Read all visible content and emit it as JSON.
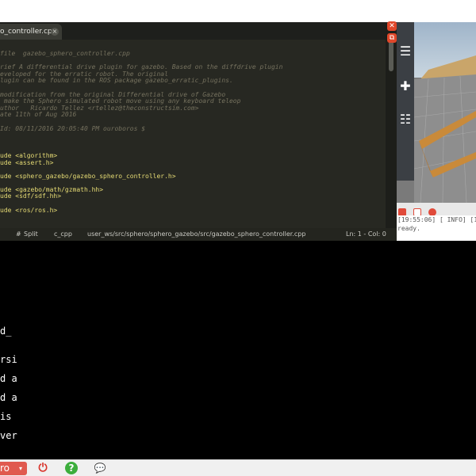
{
  "editor": {
    "tab_label": "o_controller.cpp",
    "tab_close_glyph": "×",
    "code_lines": [
      {
        "cls": "cm",
        "text": "file  gazebo_sphero_controller.cpp"
      },
      {
        "cls": "cm",
        "text": ""
      },
      {
        "cls": "cm",
        "text": "rief A differential drive plugin for gazebo. Based on the diffdrive plugin"
      },
      {
        "cls": "cm",
        "text": "eveloped for the erratic robot. The original"
      },
      {
        "cls": "cm",
        "text": "lugin can be found in the ROS package gazebo_erratic_plugins."
      },
      {
        "cls": "cm",
        "text": ""
      },
      {
        "cls": "cm",
        "text": "modification from the original Differential drive of Gazebo"
      },
      {
        "cls": "cm",
        "text": " make the Sphero simulated robot move using any keyboard teleop"
      },
      {
        "cls": "cm",
        "text": "uthor   Ricardo Tellez <rtellez@theconstructsim.com>"
      },
      {
        "cls": "cm",
        "text": "ate 11th of Aug 2016"
      },
      {
        "cls": "cm",
        "text": ""
      },
      {
        "cls": "cm",
        "text": "Id: 08/11/2016 20:05:40 PM ouroboros $"
      },
      {
        "cls": "pl",
        "text": ""
      },
      {
        "cls": "pl",
        "text": ""
      },
      {
        "cls": "pl",
        "text": ""
      },
      {
        "cls": "st",
        "text": "ude <algorithm>"
      },
      {
        "cls": "st",
        "text": "ude <assert.h>"
      },
      {
        "cls": "pl",
        "text": ""
      },
      {
        "cls": "st",
        "text": "ude <sphero_gazebo/gazebo_sphero_controller.h>"
      },
      {
        "cls": "pl",
        "text": ""
      },
      {
        "cls": "st",
        "text": "ude <gazebo/math/gzmath.hh>"
      },
      {
        "cls": "st",
        "text": "ude <sdf/sdf.hh>"
      },
      {
        "cls": "pl",
        "text": ""
      },
      {
        "cls": "st",
        "text": "ude <ros/ros.h>"
      }
    ]
  },
  "statusbar": {
    "hash": "#",
    "split": "Split",
    "lang": "c_cpp",
    "path": "user_ws/src/sphero/sphero_gazebo/src/gazebo_sphero_controller.cpp",
    "position": "Ln: 1 - Col: 0"
  },
  "window_buttons": {
    "close_glyph": "✕",
    "popout_glyph": "⧉"
  },
  "gazebo": {
    "tools": [
      "☰",
      "✚",
      "☷"
    ],
    "log_lines": [
      "[19:55:06] [ INFO] [1489",
      "ready."
    ]
  },
  "terminal": {
    "lines": [
      "d_",
      "rsi",
      "d a",
      "d a",
      "is",
      "ver"
    ]
  },
  "bottombar": {
    "ros_label": "ro",
    "ros_caret": "▾",
    "power_glyph": "⏻",
    "help_glyph": "?",
    "chat_glyph": "💬"
  },
  "colors": {
    "editor_bg": "#272822",
    "comment": "#75715e",
    "string": "#e6db74",
    "accent_red": "#e0472a",
    "ros_red": "#e05a4f",
    "help_green": "#3cae3c",
    "power_red": "#d9342b"
  }
}
